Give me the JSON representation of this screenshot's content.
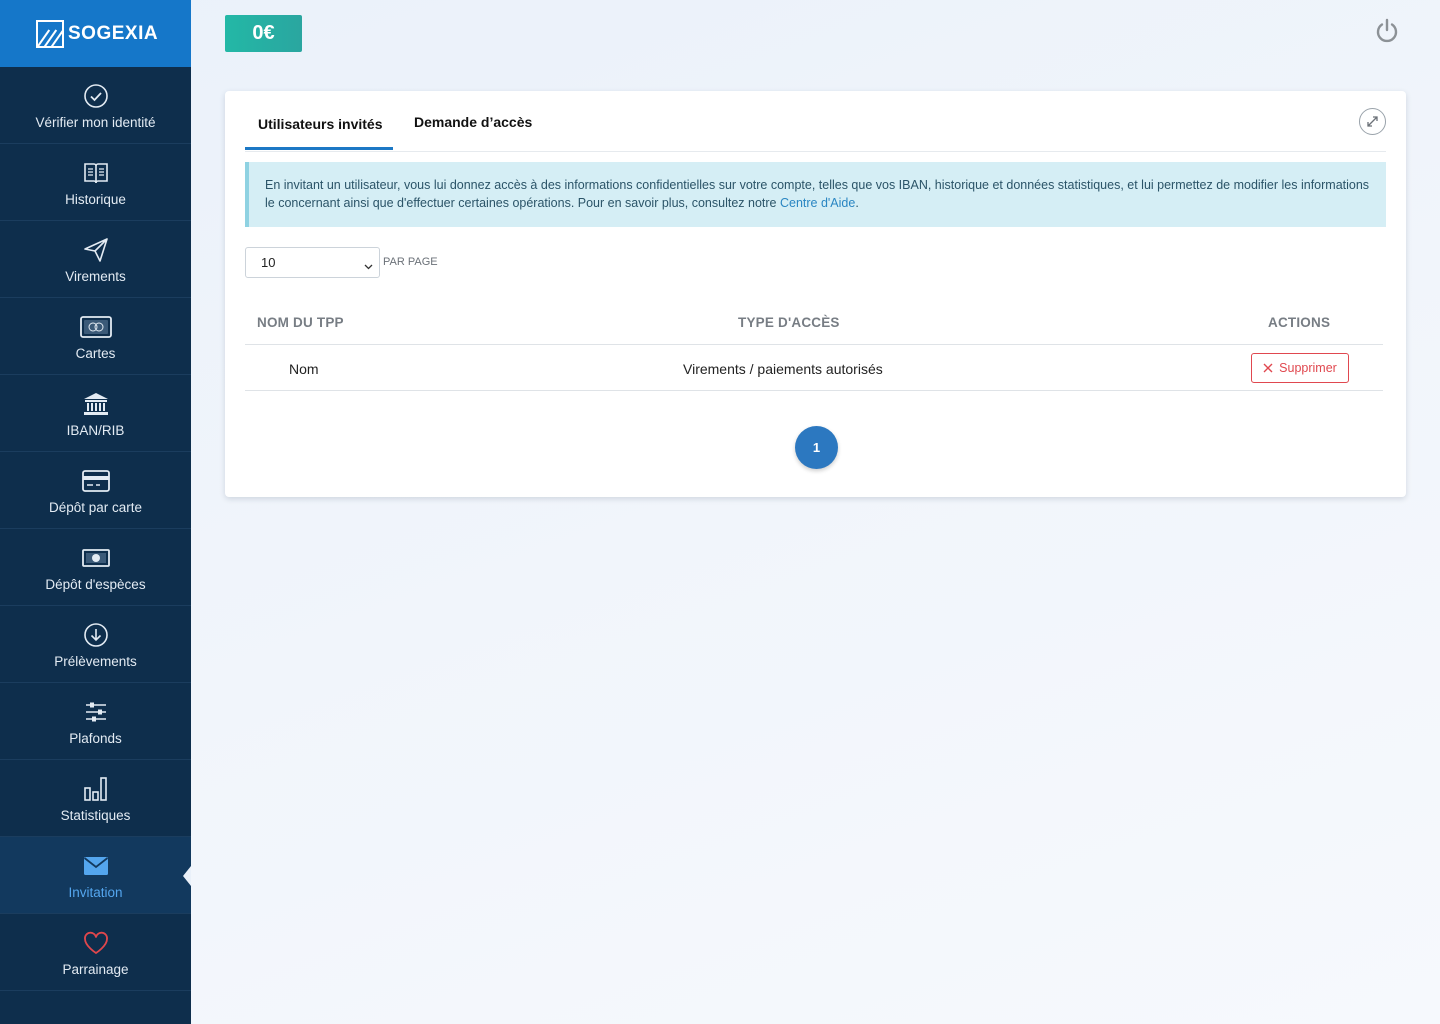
{
  "brand": {
    "name": "SOGEXIA",
    "color": "#1577c9"
  },
  "topbar": {
    "balance": "0€",
    "power_icon": "power-icon"
  },
  "sidebar": {
    "items": [
      {
        "label": "Vérifier mon identité",
        "icon": "check-circle-icon"
      },
      {
        "label": "Historique",
        "icon": "book-icon"
      },
      {
        "label": "Virements",
        "icon": "paper-plane-icon"
      },
      {
        "label": "Cartes",
        "icon": "credit-card-icon"
      },
      {
        "label": "IBAN/RIB",
        "icon": "bank-icon"
      },
      {
        "label": "Dépôt par carte",
        "icon": "card-deposit-icon"
      },
      {
        "label": "Dépôt d'espèces",
        "icon": "cash-icon"
      },
      {
        "label": "Prélèvements",
        "icon": "download-circle-icon"
      },
      {
        "label": "Plafonds",
        "icon": "sliders-icon"
      },
      {
        "label": "Statistiques",
        "icon": "bar-chart-icon"
      },
      {
        "label": "Invitation",
        "icon": "envelope-icon",
        "active": true
      },
      {
        "label": "Parrainage",
        "icon": "heart-icon"
      }
    ]
  },
  "tabs": [
    {
      "label": "Utilisateurs invités",
      "active": true
    },
    {
      "label": "Demande d’accès",
      "active": false
    }
  ],
  "alert": {
    "text": "En invitant un utilisateur, vous lui donnez accès à des informations confidentielles sur votre compte, telles que vos IBAN, historique et données statistiques, et lui permettez de modifier les informations le concernant ainsi que d'effectuer certaines opérations. Pour en savoir plus, consultez notre ",
    "link": "Centre d'Aide",
    "end": "."
  },
  "pagination": {
    "per_page_value": "10",
    "per_page_label": "PAR PAGE",
    "current_page": "1"
  },
  "table": {
    "headers": [
      "NOM DU TPP",
      "TYPE D'ACCÈS",
      "ACTIONS"
    ],
    "rows": [
      {
        "name": "Nom",
        "access": "Virements / paiements autorisés",
        "action": "Supprimer"
      }
    ]
  }
}
